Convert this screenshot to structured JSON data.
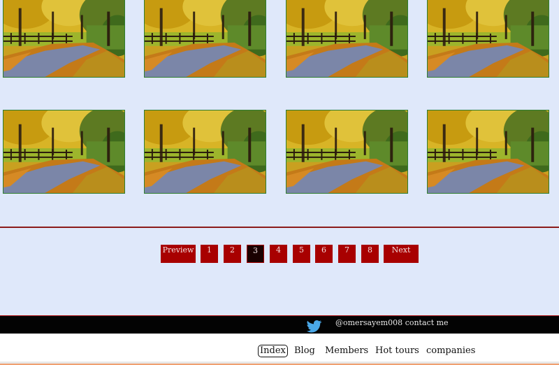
{
  "gallery": {
    "photo_icon": "autumn-path-photo",
    "rows": 2,
    "columns": 4
  },
  "pagination": {
    "previous_label": "Preview",
    "pages": [
      "1",
      "2",
      "3",
      "4",
      "5",
      "6",
      "7",
      "8"
    ],
    "current_page": "3",
    "next_label": "Next"
  },
  "social_bar": {
    "icon": "twitter-bird-icon",
    "handle": "@omersayem008",
    "contact_label": "contact me"
  },
  "nav": {
    "items": [
      "Index",
      "Blog",
      "Members",
      "Hot tours",
      "companies"
    ],
    "current": "Index"
  },
  "colors": {
    "page_background": "#dfe8fa",
    "pager_button": "#a80000",
    "pager_active": "#1a0000",
    "divider": "#8b1a1a",
    "social_bar": "#030303",
    "twitter_blue": "#4aa8e8"
  }
}
